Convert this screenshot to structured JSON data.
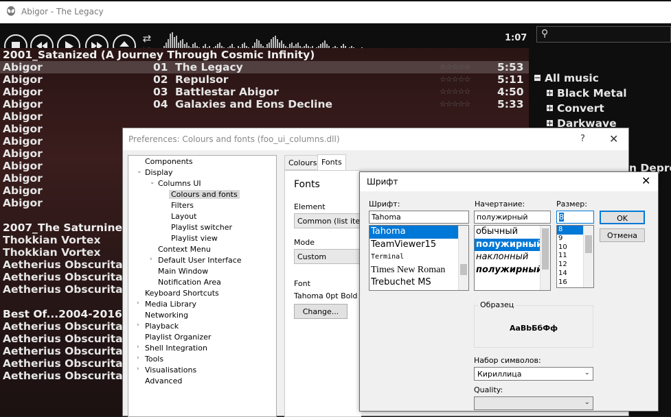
{
  "window": {
    "title": "Abigor - The Legacy"
  },
  "player": {
    "time": "1:07",
    "visualizer_levels": [
      0.5,
      0.6,
      0.7,
      0.85,
      0.9,
      0.75,
      0.8,
      0.6,
      0.65,
      0.7,
      0.55,
      0.6,
      0.5,
      0.45,
      0.55,
      0.6,
      0.5,
      0.45,
      0.4,
      0.5,
      0.55,
      0.45,
      0.5,
      0.4,
      0.45,
      0.5,
      0.55,
      0.6,
      0.5,
      0.45,
      0.4,
      0.45,
      0.5,
      0.55,
      0.45,
      0.4,
      0.5,
      0.45,
      0.55,
      0.6,
      0.5,
      0.45,
      0.4,
      0.5,
      0.6,
      0.7,
      0.65,
      0.55,
      0.5,
      0.45,
      0.55,
      0.6,
      0.7,
      0.75,
      0.8,
      0.7,
      0.6,
      0.65,
      0.55,
      0.5,
      0.45,
      0.55,
      0.6,
      0.5,
      0.55,
      0.6,
      0.5,
      0.45,
      0.5,
      0.55,
      0.5,
      0.45,
      0.5,
      0.4,
      0.45,
      0.5,
      0.55,
      0.6,
      0.65,
      0.55,
      0.5,
      0.4,
      0.45,
      0.5,
      0.45,
      0.4,
      0.5,
      0.55,
      0.5,
      0.4,
      0.45,
      0.5,
      0.45,
      0.4,
      0.35,
      0.4,
      0.45,
      0.35,
      0.3,
      0.35,
      0.4,
      0.3,
      0.25,
      0.3,
      0.2,
      0.25,
      0.2,
      0.15,
      0.2,
      0.15,
      0.1,
      0.15,
      0.1,
      0.05,
      0.1,
      0.05,
      0.1,
      0.05,
      0.08,
      0.05
    ]
  },
  "playlist": {
    "rows": [
      {
        "type": "group",
        "text": "2001_Satanized (A Journey Through Cosmic Infinity)"
      },
      {
        "type": "track",
        "artist": "Abigor",
        "num": "01",
        "title": "The Legacy",
        "duration": "5:53",
        "current": true
      },
      {
        "type": "track",
        "artist": "Abigor",
        "num": "02",
        "title": "Repulsor",
        "duration": "5:11"
      },
      {
        "type": "track",
        "artist": "Abigor",
        "num": "03",
        "title": "Battlestar Abigor",
        "duration": "4:50"
      },
      {
        "type": "track",
        "artist": "Abigor",
        "num": "04",
        "title": "Galaxies and Eons Decline",
        "duration": "5:33"
      },
      {
        "type": "track",
        "artist": "Abigor"
      },
      {
        "type": "track",
        "artist": "Abigor"
      },
      {
        "type": "track",
        "artist": "Abigor"
      },
      {
        "type": "track",
        "artist": "Abigor"
      },
      {
        "type": "track",
        "artist": "Abigor"
      },
      {
        "type": "track",
        "artist": "Abigor"
      },
      {
        "type": "track",
        "artist": "Abigor"
      },
      {
        "type": "track",
        "artist": "Abigor"
      },
      {
        "type": "blank"
      },
      {
        "type": "group",
        "text": "2007_The Saturnine A"
      },
      {
        "type": "track",
        "artist": "Thokkian Vortex"
      },
      {
        "type": "track",
        "artist": "Thokkian Vortex"
      },
      {
        "type": "track",
        "artist": "Aetherius Obscuritas"
      },
      {
        "type": "track",
        "artist": "Aetherius Obscuritas"
      },
      {
        "type": "track",
        "artist": "Aetherius Obscuritas"
      },
      {
        "type": "blank"
      },
      {
        "type": "group",
        "text": "Best Of...2004-2016"
      },
      {
        "type": "track",
        "artist": "Aetherius Obscuritas"
      },
      {
        "type": "track",
        "artist": "Aetherius Obscuritas"
      },
      {
        "type": "track",
        "artist": "Aetherius Obscuritas"
      },
      {
        "type": "track",
        "artist": "Aetherius Obscuritas"
      },
      {
        "type": "track",
        "artist": "Aetherius Obscuritas"
      }
    ]
  },
  "library": {
    "root": "All music",
    "items": [
      "Black Metal",
      "Convert",
      "Darkwave"
    ],
    "partial": "n Depre"
  },
  "prefs": {
    "title": "Preferences: Colours and fonts (foo_ui_columns.dll)",
    "help": "?",
    "close": "✕",
    "tree": [
      {
        "label": "Components",
        "level": 0
      },
      {
        "label": "Display",
        "level": 0,
        "arrow": "open"
      },
      {
        "label": "Columns UI",
        "level": 1,
        "arrow": "open"
      },
      {
        "label": "Colours and fonts",
        "level": 2,
        "selected": true
      },
      {
        "label": "Filters",
        "level": 2
      },
      {
        "label": "Layout",
        "level": 2
      },
      {
        "label": "Playlist switcher",
        "level": 2
      },
      {
        "label": "Playlist view",
        "level": 2
      },
      {
        "label": "Context Menu",
        "level": 1
      },
      {
        "label": "Default User Interface",
        "level": 1,
        "arrow": "closed"
      },
      {
        "label": "Main Window",
        "level": 1
      },
      {
        "label": "Notification Area",
        "level": 1
      },
      {
        "label": "Keyboard Shortcuts",
        "level": 0
      },
      {
        "label": "Media Library",
        "level": 0,
        "arrow": "closed"
      },
      {
        "label": "Networking",
        "level": 0
      },
      {
        "label": "Playback",
        "level": 0,
        "arrow": "closed"
      },
      {
        "label": "Playlist Organizer",
        "level": 0
      },
      {
        "label": "Shell Integration",
        "level": 0,
        "arrow": "closed"
      },
      {
        "label": "Tools",
        "level": 0,
        "arrow": "closed"
      },
      {
        "label": "Visualisations",
        "level": 0,
        "arrow": "closed"
      },
      {
        "label": "Advanced",
        "level": 0
      }
    ],
    "tabs": {
      "colours": "Colours",
      "fonts": "Fonts"
    },
    "panel": {
      "heading": "Fonts",
      "element_label": "Element",
      "element_value": "Common (list items)",
      "mode_label": "Mode",
      "mode_value": "Custom",
      "font_label": "Font",
      "font_value": "Tahoma 0pt Bold",
      "change_button": "Change..."
    }
  },
  "fontdlg": {
    "title": "Шрифт",
    "close": "✕",
    "font_label": "Шрифт:",
    "font_value": "Tahoma",
    "fonts": [
      "Tahoma",
      "TeamViewer15",
      "Terminal",
      "Times New Roman",
      "Trebuchet MS"
    ],
    "style_label": "Начертание:",
    "style_value": "полужирный",
    "styles": [
      "обычный",
      "полужирный",
      "наклонный",
      "полужирный"
    ],
    "size_label": "Размер:",
    "size_value": "8",
    "sizes": [
      "8",
      "9",
      "10",
      "11",
      "12",
      "14",
      "16"
    ],
    "ok": "OK",
    "cancel": "Отмена",
    "sample_label": "Образец",
    "sample_text": "AaBbБбФф",
    "charset_label": "Набор символов:",
    "charset_value": "Кириллица",
    "quality_label": "Quality:",
    "quality_value": ""
  }
}
